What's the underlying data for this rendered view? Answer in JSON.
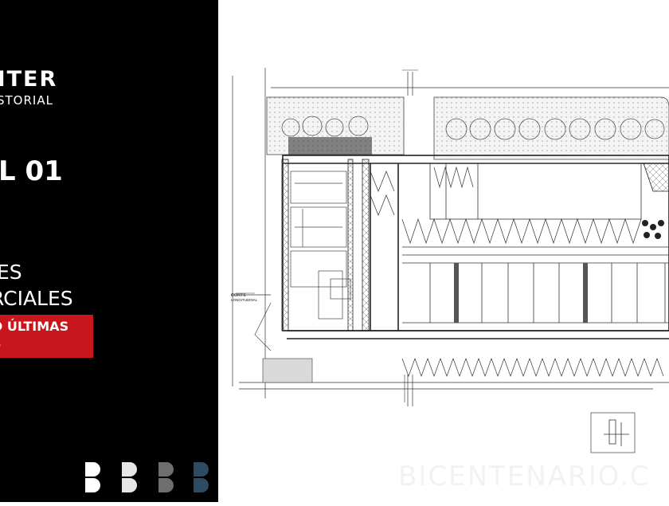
{
  "brand": {
    "name": "NTER",
    "subtitle": "STORIAL"
  },
  "level_title": "L 01",
  "heading": {
    "line1": "ES",
    "line2": "RCIALES"
  },
  "banner": {
    "line1": "D ÚLTIMAS",
    "line2": "S",
    "color": "#c9161d"
  },
  "plan_labels": {
    "corte": "CORTE",
    "corte_sub": "LONGITUDINAL"
  },
  "watermark": "BICENTENARIO.C",
  "logo_letters": [
    "B",
    "B",
    "B",
    "B"
  ],
  "logo_colors": [
    "#ffffff",
    "#e6e6e6",
    "#6e6e6e",
    "#2f4a63"
  ]
}
